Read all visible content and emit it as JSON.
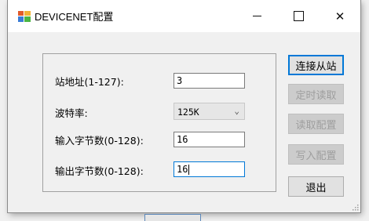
{
  "window": {
    "title": "DEVICENET配置"
  },
  "title_controls": {
    "minimize": "—",
    "close": "✕"
  },
  "form": {
    "station_label": "站地址(1-127):",
    "station_value": "3",
    "baud_label": "波特率:",
    "baud_value": "125K",
    "input_bytes_label": "输入字节数(0-128):",
    "input_bytes_value": "16",
    "output_bytes_label": "输出字节数(0-128):",
    "output_bytes_value": "16"
  },
  "buttons": {
    "connect": "连接从站",
    "timed_read": "定时读取",
    "read_config": "读取配置",
    "write_config": "写入配置",
    "exit": "退出"
  },
  "colors": {
    "accent": "#0078d7",
    "disabled_text": "#9e9e9e"
  }
}
